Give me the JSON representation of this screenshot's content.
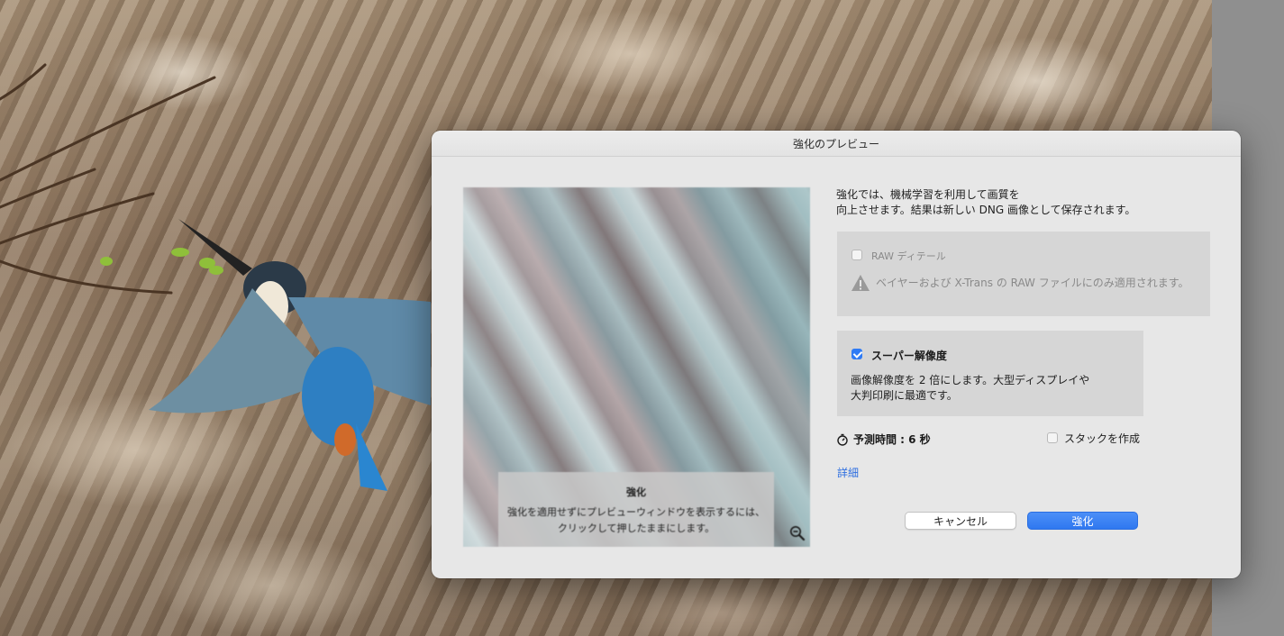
{
  "dialog": {
    "title": "強化のプレビュー",
    "description_line1": "強化では、機械学習を利用して画質を",
    "description_line2": "向上させます。結果は新しい DNG 画像として保存されます。"
  },
  "preview": {
    "tip_title": "強化",
    "tip_line1": "強化を適用せずにプレビューウィンドウを表示するには、",
    "tip_line2": "クリックして押したままにします。",
    "zoom_icon": "zoom-out-icon"
  },
  "raw_detail": {
    "label": "RAW ディテール",
    "checked": false,
    "enabled": false,
    "warning": "ベイヤーおよび X-Trans の RAW ファイルにのみ適用されます。",
    "warning_icon": "warning-icon"
  },
  "super_resolution": {
    "label": "スーパー解像度",
    "checked": true,
    "desc_line1": "画像解像度を 2 倍にします。大型ディスプレイや",
    "desc_line2": "大判印刷に最適です。"
  },
  "estimate": {
    "icon": "timer-icon",
    "text": "予測時間 : 6 秒"
  },
  "stack": {
    "label": "スタックを作成",
    "checked": false
  },
  "details_link": "詳細",
  "buttons": {
    "cancel": "キャンセル",
    "enhance": "強化"
  },
  "colors": {
    "accent": "#2f7bf5",
    "link": "#2f6fe0"
  }
}
